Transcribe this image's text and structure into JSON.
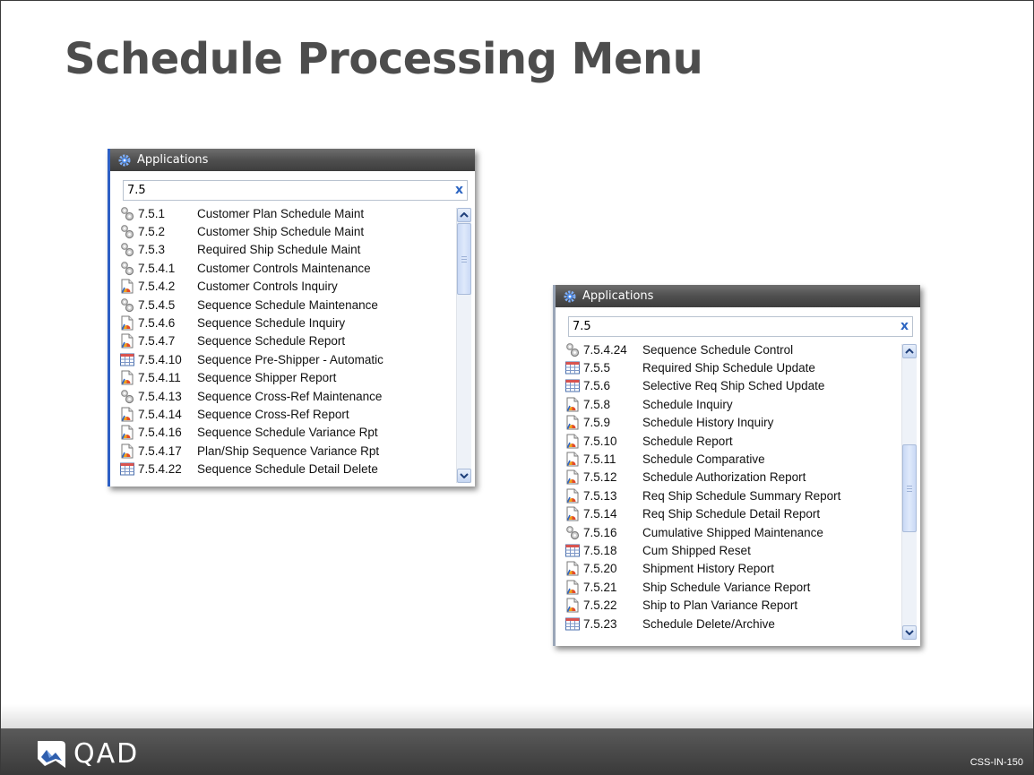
{
  "slide": {
    "title": "Schedule Processing Menu",
    "footer_code": "CSS-IN-150",
    "logo_text": "QAD"
  },
  "panel_left": {
    "header": "Applications",
    "search_value": "7.5",
    "clear_label": "x",
    "items": [
      {
        "code": "7.5.1",
        "name": "Customer Plan Schedule Maint",
        "icon": "gear-icon"
      },
      {
        "code": "7.5.2",
        "name": "Customer Ship Schedule Maint",
        "icon": "gear-icon"
      },
      {
        "code": "7.5.3",
        "name": "Required Ship Schedule Maint",
        "icon": "gear-icon"
      },
      {
        "code": "7.5.4.1",
        "name": "Customer Controls Maintenance",
        "icon": "gear-icon"
      },
      {
        "code": "7.5.4.2",
        "name": "Customer Controls Inquiry",
        "icon": "report-icon"
      },
      {
        "code": "7.5.4.5",
        "name": "Sequence Schedule Maintenance",
        "icon": "gear-icon"
      },
      {
        "code": "7.5.4.6",
        "name": "Sequence Schedule Inquiry",
        "icon": "report-icon"
      },
      {
        "code": "7.5.4.7",
        "name": "Sequence Schedule Report",
        "icon": "report-icon"
      },
      {
        "code": "7.5.4.10",
        "name": "Sequence Pre-Shipper - Automatic",
        "icon": "table-icon"
      },
      {
        "code": "7.5.4.11",
        "name": "Sequence Shipper Report",
        "icon": "report-icon"
      },
      {
        "code": "7.5.4.13",
        "name": "Sequence Cross-Ref Maintenance",
        "icon": "gear-icon"
      },
      {
        "code": "7.5.4.14",
        "name": "Sequence Cross-Ref Report",
        "icon": "report-icon"
      },
      {
        "code": "7.5.4.16",
        "name": "Sequence Schedule Variance Rpt",
        "icon": "report-icon"
      },
      {
        "code": "7.5.4.17",
        "name": "Plan/Ship Sequence Variance Rpt",
        "icon": "report-icon"
      },
      {
        "code": "7.5.4.22",
        "name": "Sequence Schedule Detail Delete",
        "icon": "table-icon"
      }
    ]
  },
  "panel_right": {
    "header": "Applications",
    "search_value": "7.5",
    "clear_label": "x",
    "items": [
      {
        "code": "7.5.4.24",
        "name": "Sequence Schedule Control",
        "icon": "gear-icon"
      },
      {
        "code": "7.5.5",
        "name": "Required Ship Schedule Update",
        "icon": "table-icon"
      },
      {
        "code": "7.5.6",
        "name": "Selective Req Ship Sched Update",
        "icon": "table-icon"
      },
      {
        "code": "7.5.8",
        "name": "Schedule Inquiry",
        "icon": "report-icon"
      },
      {
        "code": "7.5.9",
        "name": "Schedule History Inquiry",
        "icon": "report-icon"
      },
      {
        "code": "7.5.10",
        "name": "Schedule Report",
        "icon": "report-icon"
      },
      {
        "code": "7.5.11",
        "name": "Schedule Comparative",
        "icon": "report-icon"
      },
      {
        "code": "7.5.12",
        "name": "Schedule Authorization Report",
        "icon": "report-icon"
      },
      {
        "code": "7.5.13",
        "name": "Req Ship Schedule Summary Report",
        "icon": "report-icon"
      },
      {
        "code": "7.5.14",
        "name": "Req Ship Schedule Detail Report",
        "icon": "report-icon"
      },
      {
        "code": "7.5.16",
        "name": "Cumulative Shipped Maintenance",
        "icon": "gear-icon"
      },
      {
        "code": "7.5.18",
        "name": "Cum Shipped Reset",
        "icon": "table-icon"
      },
      {
        "code": "7.5.20",
        "name": "Shipment History Report",
        "icon": "report-icon"
      },
      {
        "code": "7.5.21",
        "name": "Ship Schedule Variance Report",
        "icon": "report-icon"
      },
      {
        "code": "7.5.22",
        "name": "Ship to Plan Variance Report",
        "icon": "report-icon"
      },
      {
        "code": "7.5.23",
        "name": "Schedule Delete/Archive",
        "icon": "table-icon"
      }
    ]
  }
}
